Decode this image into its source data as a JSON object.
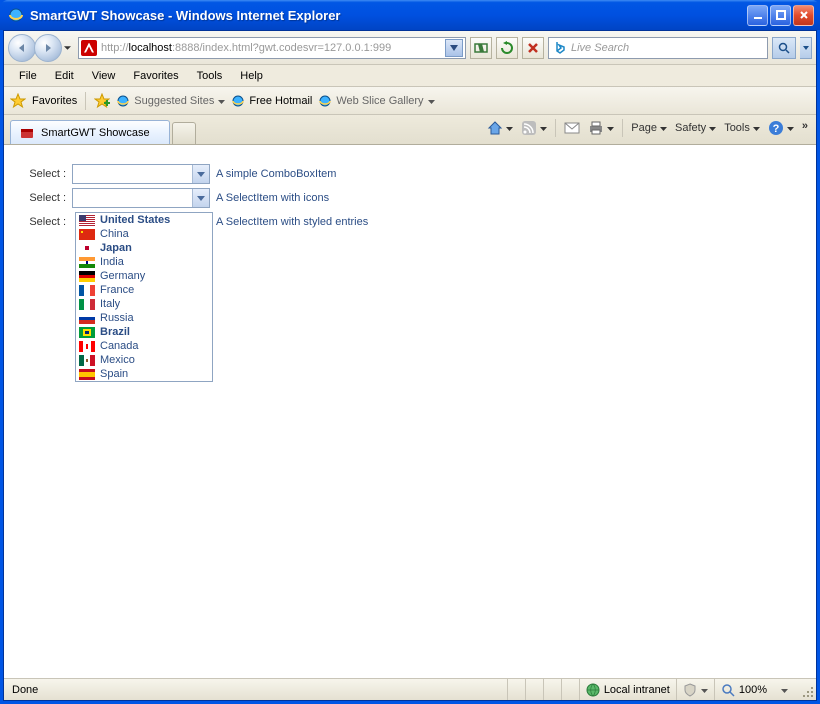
{
  "window": {
    "title": "SmartGWT Showcase - Windows Internet Explorer"
  },
  "address": {
    "prefix": "http://",
    "host": "localhost",
    "rest": ":8888/index.html?gwt.codesvr=127.0.0.1:999"
  },
  "search": {
    "placeholder": "Live Search"
  },
  "menu": [
    "File",
    "Edit",
    "View",
    "Favorites",
    "Tools",
    "Help"
  ],
  "favbar": {
    "label": "Favorites",
    "links": [
      {
        "label": "Suggested Sites"
      },
      {
        "label": "Free Hotmail"
      },
      {
        "label": "Web Slice Gallery"
      }
    ]
  },
  "tab": {
    "title": "SmartGWT Showcase"
  },
  "cmdbar": {
    "page": "Page",
    "safety": "Safety",
    "tools": "Tools"
  },
  "form": {
    "label": "Select :",
    "hints": [
      "A simple ComboBoxItem",
      "A SelectItem with icons",
      "A SelectItem with styled entries"
    ]
  },
  "dropdown": [
    {
      "name": "United States",
      "bold": true,
      "flag": "us"
    },
    {
      "name": "China",
      "bold": false,
      "flag": "cn"
    },
    {
      "name": "Japan",
      "bold": true,
      "flag": "jp"
    },
    {
      "name": "India",
      "bold": false,
      "flag": "in"
    },
    {
      "name": "Germany",
      "bold": false,
      "flag": "de"
    },
    {
      "name": "France",
      "bold": false,
      "flag": "fr"
    },
    {
      "name": "Italy",
      "bold": false,
      "flag": "it"
    },
    {
      "name": "Russia",
      "bold": false,
      "flag": "ru"
    },
    {
      "name": "Brazil",
      "bold": true,
      "flag": "br"
    },
    {
      "name": "Canada",
      "bold": false,
      "flag": "ca"
    },
    {
      "name": "Mexico",
      "bold": false,
      "flag": "mx"
    },
    {
      "name": "Spain",
      "bold": false,
      "flag": "es"
    }
  ],
  "status": {
    "left": "Done",
    "zone": "Local intranet",
    "zoom": "100%"
  },
  "flags": {
    "us": [
      [
        "#b22234",
        0,
        0,
        16,
        11
      ],
      [
        "#ffffff",
        0,
        1,
        16,
        1
      ],
      [
        "#ffffff",
        0,
        3,
        16,
        1
      ],
      [
        "#ffffff",
        0,
        5,
        16,
        1
      ],
      [
        "#ffffff",
        0,
        7,
        16,
        1
      ],
      [
        "#ffffff",
        0,
        9,
        16,
        1
      ],
      [
        "#3c3b6e",
        0,
        0,
        7,
        6
      ]
    ],
    "cn": [
      [
        "#de2910",
        0,
        0,
        16,
        11
      ],
      [
        "#ffde00",
        2,
        2,
        2,
        2
      ]
    ],
    "jp": [
      [
        "#ffffff",
        0,
        0,
        16,
        11
      ],
      [
        "#bc002d",
        6,
        3,
        4,
        4
      ]
    ],
    "in": [
      [
        "#ff9933",
        0,
        0,
        16,
        4
      ],
      [
        "#ffffff",
        0,
        4,
        16,
        3
      ],
      [
        "#138808",
        0,
        7,
        16,
        4
      ],
      [
        "#000080",
        7,
        4,
        2,
        3
      ]
    ],
    "de": [
      [
        "#000000",
        0,
        0,
        16,
        4
      ],
      [
        "#dd0000",
        0,
        4,
        16,
        3
      ],
      [
        "#ffce00",
        0,
        7,
        16,
        4
      ]
    ],
    "fr": [
      [
        "#0055a4",
        0,
        0,
        5,
        11
      ],
      [
        "#ffffff",
        5,
        0,
        6,
        11
      ],
      [
        "#ef4135",
        11,
        0,
        5,
        11
      ]
    ],
    "it": [
      [
        "#009246",
        0,
        0,
        5,
        11
      ],
      [
        "#ffffff",
        5,
        0,
        6,
        11
      ],
      [
        "#ce2b37",
        11,
        0,
        5,
        11
      ]
    ],
    "ru": [
      [
        "#ffffff",
        0,
        0,
        16,
        4
      ],
      [
        "#0039a6",
        0,
        4,
        16,
        3
      ],
      [
        "#d52b1e",
        0,
        7,
        16,
        4
      ]
    ],
    "br": [
      [
        "#009c3b",
        0,
        0,
        16,
        11
      ],
      [
        "#ffdf00",
        4,
        2,
        8,
        7
      ],
      [
        "#002776",
        6,
        4,
        4,
        3
      ]
    ],
    "ca": [
      [
        "#ff0000",
        0,
        0,
        4,
        11
      ],
      [
        "#ffffff",
        4,
        0,
        8,
        11
      ],
      [
        "#ff0000",
        12,
        0,
        4,
        11
      ],
      [
        "#ff0000",
        7,
        3,
        2,
        5
      ]
    ],
    "mx": [
      [
        "#006847",
        0,
        0,
        5,
        11
      ],
      [
        "#ffffff",
        5,
        0,
        6,
        11
      ],
      [
        "#ce1126",
        11,
        0,
        5,
        11
      ],
      [
        "#8a5a2b",
        7,
        4,
        2,
        3
      ]
    ],
    "es": [
      [
        "#c60b1e",
        0,
        0,
        16,
        3
      ],
      [
        "#ffc400",
        0,
        3,
        16,
        5
      ],
      [
        "#c60b1e",
        0,
        8,
        16,
        3
      ]
    ]
  }
}
